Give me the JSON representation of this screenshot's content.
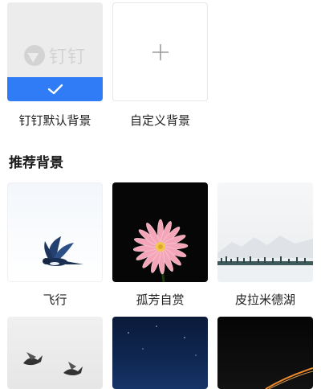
{
  "top_options": [
    {
      "label": "钉钉默认背景",
      "logo_text": "钉钉",
      "selected": true
    },
    {
      "label": "自定义背景",
      "icon": "plus-icon"
    }
  ],
  "recommended": {
    "title": "推荐背景",
    "items": [
      {
        "label": "飞行"
      },
      {
        "label": "孤芳自赏"
      },
      {
        "label": "皮拉米德湖"
      },
      {
        "label": ""
      },
      {
        "label": ""
      },
      {
        "label": ""
      }
    ]
  },
  "colors": {
    "accent": "#2f7cf6",
    "tile_default_bg": "#ececec"
  }
}
